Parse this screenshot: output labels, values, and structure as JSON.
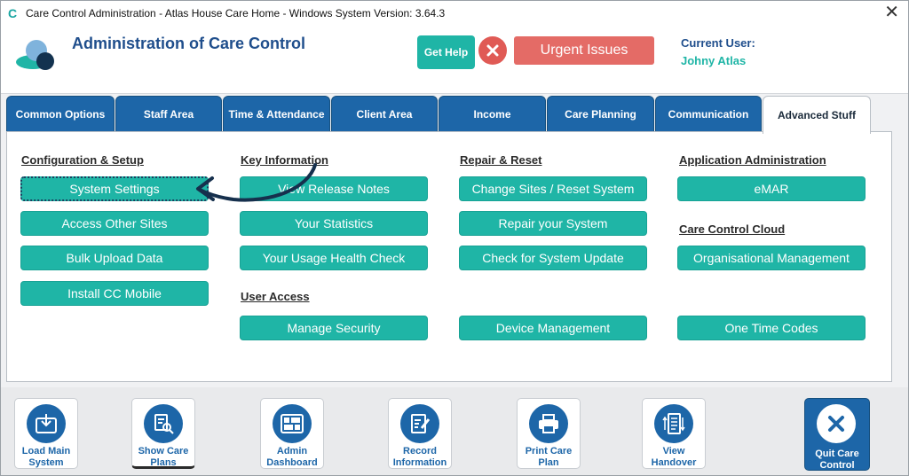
{
  "window": {
    "title": "Care Control Administration - Atlas House Care Home - Windows System Version: 3.64.3",
    "close_glyph": "✕"
  },
  "header": {
    "title": "Administration of Care Control",
    "help_label": "Get Help",
    "urgent_label": "Urgent Issues",
    "current_user_label": "Current User:",
    "current_user": "Johny Atlas"
  },
  "tabs": [
    {
      "label": "Common Options"
    },
    {
      "label": "Staff Area"
    },
    {
      "label": "Time & Attendance"
    },
    {
      "label": "Client Area"
    },
    {
      "label": "Income"
    },
    {
      "label": "Care Planning"
    },
    {
      "label": "Communication"
    },
    {
      "label": "Advanced Stuff"
    }
  ],
  "active_tab": "Advanced Stuff",
  "sections": {
    "config": {
      "title": "Configuration & Setup",
      "buttons": [
        "System Settings",
        "Access Other Sites",
        "Bulk Upload Data",
        "Install CC Mobile"
      ]
    },
    "keyinfo": {
      "title": "Key Information",
      "buttons": [
        "View Release Notes",
        "Your Statistics",
        "Your Usage Health Check"
      ]
    },
    "useraccess": {
      "title": "User Access",
      "buttons": [
        "Manage Security"
      ]
    },
    "repair": {
      "title": "Repair & Reset",
      "buttons": [
        "Change Sites / Reset System",
        "Repair your System",
        "Check for System Update",
        "Device Management"
      ]
    },
    "appadmin": {
      "title": "Application Administration",
      "buttons": [
        "eMAR"
      ]
    },
    "cloud": {
      "title": "Care Control Cloud",
      "buttons": [
        "Organisational Management",
        "One Time Codes"
      ]
    }
  },
  "toolbar": [
    {
      "label": "Load Main\nSystem",
      "icon": "load-icon"
    },
    {
      "label": "Show Care\nPlans",
      "icon": "care-plans-icon"
    },
    {
      "label": "Admin\nDashboard",
      "icon": "dashboard-icon"
    },
    {
      "label": "Record\nInformation",
      "icon": "record-icon"
    },
    {
      "label": "Print Care\nPlan",
      "icon": "printer-icon"
    },
    {
      "label": "View\nHandover",
      "icon": "handover-icon"
    },
    {
      "label": "Quit Care\nControl",
      "icon": "quit-icon"
    }
  ],
  "colors": {
    "teal": "#1fb5a6",
    "blue": "#1d66a8",
    "urgent": "#e46b66",
    "title_blue": "#1f4e8c"
  }
}
